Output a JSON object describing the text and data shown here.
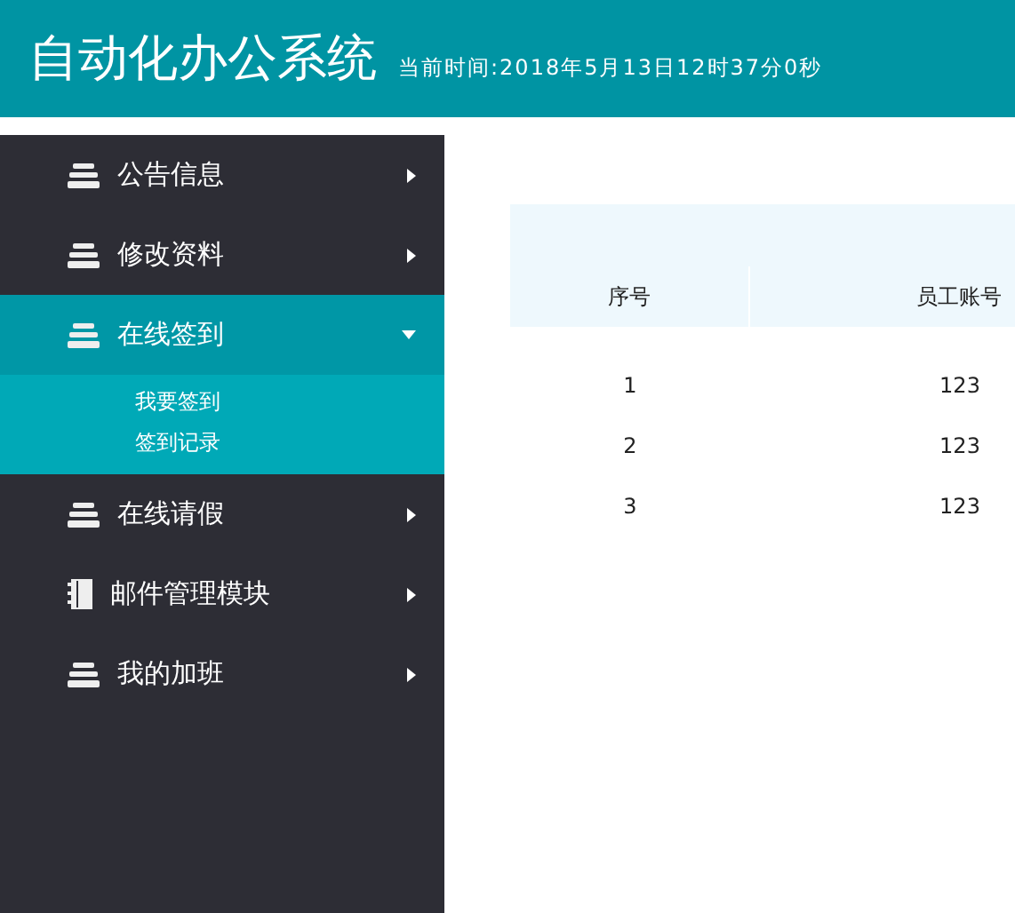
{
  "header": {
    "title": "自动化办公系统",
    "clock": "当前时间:2018年5月13日12时37分0秒"
  },
  "sidebar": {
    "items": [
      {
        "label": "公告信息",
        "kind": "stack",
        "expanded": false,
        "selected": false
      },
      {
        "label": "修改资料",
        "kind": "stack",
        "expanded": false,
        "selected": false
      },
      {
        "label": "在线签到",
        "kind": "stack",
        "expanded": true,
        "selected": true,
        "children": [
          {
            "label": "我要签到"
          },
          {
            "label": "签到记录"
          }
        ]
      },
      {
        "label": "在线请假",
        "kind": "stack",
        "expanded": false,
        "selected": false
      },
      {
        "label": "邮件管理模块",
        "kind": "book",
        "expanded": false,
        "selected": false
      },
      {
        "label": "我的加班",
        "kind": "stack",
        "expanded": false,
        "selected": false
      }
    ]
  },
  "table": {
    "columns": [
      "序号",
      "员工账号"
    ],
    "rows": [
      [
        "1",
        "123"
      ],
      [
        "2",
        "123"
      ],
      [
        "3",
        "123"
      ]
    ]
  }
}
